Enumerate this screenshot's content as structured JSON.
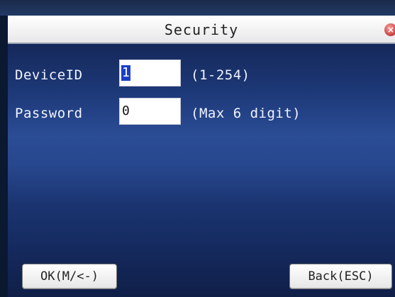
{
  "window": {
    "title": "Security",
    "close_icon": "close-icon"
  },
  "form": {
    "device_id": {
      "label": "DeviceID",
      "value": "1",
      "hint": "(1-254)"
    },
    "password": {
      "label": "Password",
      "value": "0",
      "hint": "(Max 6 digit)"
    }
  },
  "buttons": {
    "ok_label": "OK(M/<-)",
    "back_label": "Back(ESC)"
  },
  "colors": {
    "background": "#1e3a7a",
    "selection": "#1a3fc7",
    "close": "#d24b4b"
  }
}
